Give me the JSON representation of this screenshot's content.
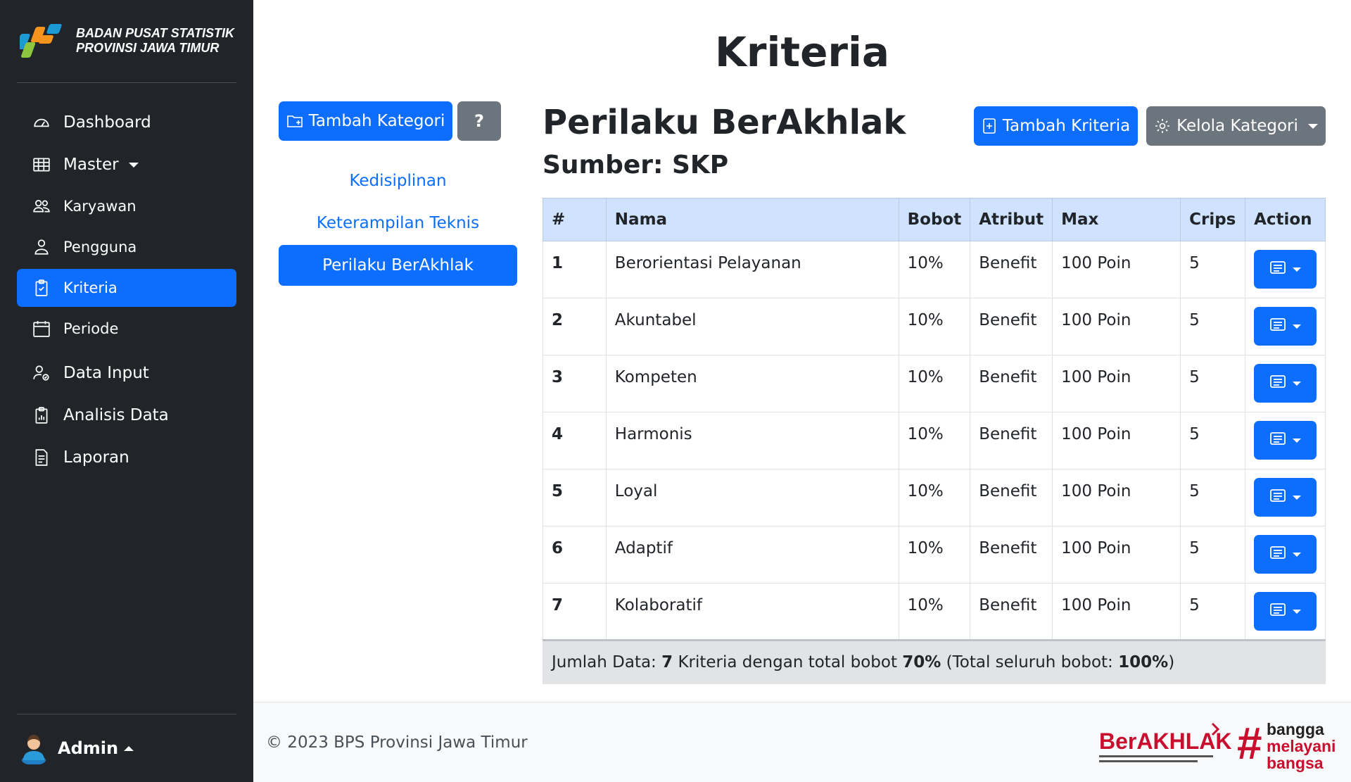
{
  "brand": {
    "line1": "BADAN PUSAT STATISTIK",
    "line2": "PROVINSI JAWA TIMUR"
  },
  "sidebar": {
    "items": [
      {
        "label": "Dashboard",
        "icon": "speedometer-icon"
      },
      {
        "label": "Master",
        "icon": "table-icon"
      },
      {
        "label": "Karyawan",
        "icon": "people-icon"
      },
      {
        "label": "Pengguna",
        "icon": "person-icon"
      },
      {
        "label": "Kriteria",
        "icon": "clipboard-check-icon",
        "active": true
      },
      {
        "label": "Periode",
        "icon": "calendar-icon"
      },
      {
        "label": "Data Input",
        "icon": "person-gear-icon"
      },
      {
        "label": "Analisis Data",
        "icon": "clipboard-data-icon"
      },
      {
        "label": "Laporan",
        "icon": "file-text-icon"
      }
    ],
    "user": "Admin"
  },
  "page": {
    "title": "Kriteria"
  },
  "categories": {
    "add_label": "Tambah Kategori",
    "help_label": "?",
    "items": [
      "Kedisiplinan",
      "Keterampilan Teknis",
      "Perilaku BerAkhlak"
    ],
    "active": "Perilaku BerAkhlak"
  },
  "section": {
    "title": "Perilaku BerAkhlak",
    "subtitle": "Sumber: SKP",
    "add_label": "Tambah Kriteria",
    "manage_label": "Kelola Kategori"
  },
  "table": {
    "headers": [
      "#",
      "Nama",
      "Bobot",
      "Atribut",
      "Max",
      "Crips",
      "Action"
    ],
    "rows": [
      [
        "1",
        "Berorientasi Pelayanan",
        "10%",
        "Benefit",
        "100 Poin",
        "5"
      ],
      [
        "2",
        "Akuntabel",
        "10%",
        "Benefit",
        "100 Poin",
        "5"
      ],
      [
        "3",
        "Kompeten",
        "10%",
        "Benefit",
        "100 Poin",
        "5"
      ],
      [
        "4",
        "Harmonis",
        "10%",
        "Benefit",
        "100 Poin",
        "5"
      ],
      [
        "5",
        "Loyal",
        "10%",
        "Benefit",
        "100 Poin",
        "5"
      ],
      [
        "6",
        "Adaptif",
        "10%",
        "Benefit",
        "100 Poin",
        "5"
      ],
      [
        "7",
        "Kolaboratif",
        "10%",
        "Benefit",
        "100 Poin",
        "5"
      ]
    ],
    "footer": {
      "prefix": "Jumlah Data: ",
      "count": "7",
      "middle": " Kriteria dengan total bobot ",
      "total": "70%",
      "suffix_open": " (Total seluruh bobot: ",
      "grand_total": "100%",
      "suffix_close": ")"
    }
  },
  "footer": {
    "copyright": "© 2023 BPS Provinsi Jawa Timur",
    "logo_berakhlak": "BerAKHLAK",
    "logo_tagline": "Berorientasi Pelayanan Akuntabel Kompeten Harmonis Loyal Adaptif Kolaboratif",
    "logo_bangga": [
      "bangga",
      "melayani",
      "bangsa"
    ]
  },
  "colors": {
    "primary": "#0d6efd",
    "secondary": "#6c757d",
    "sidebar": "#212529",
    "table_head": "#cfe2ff"
  }
}
